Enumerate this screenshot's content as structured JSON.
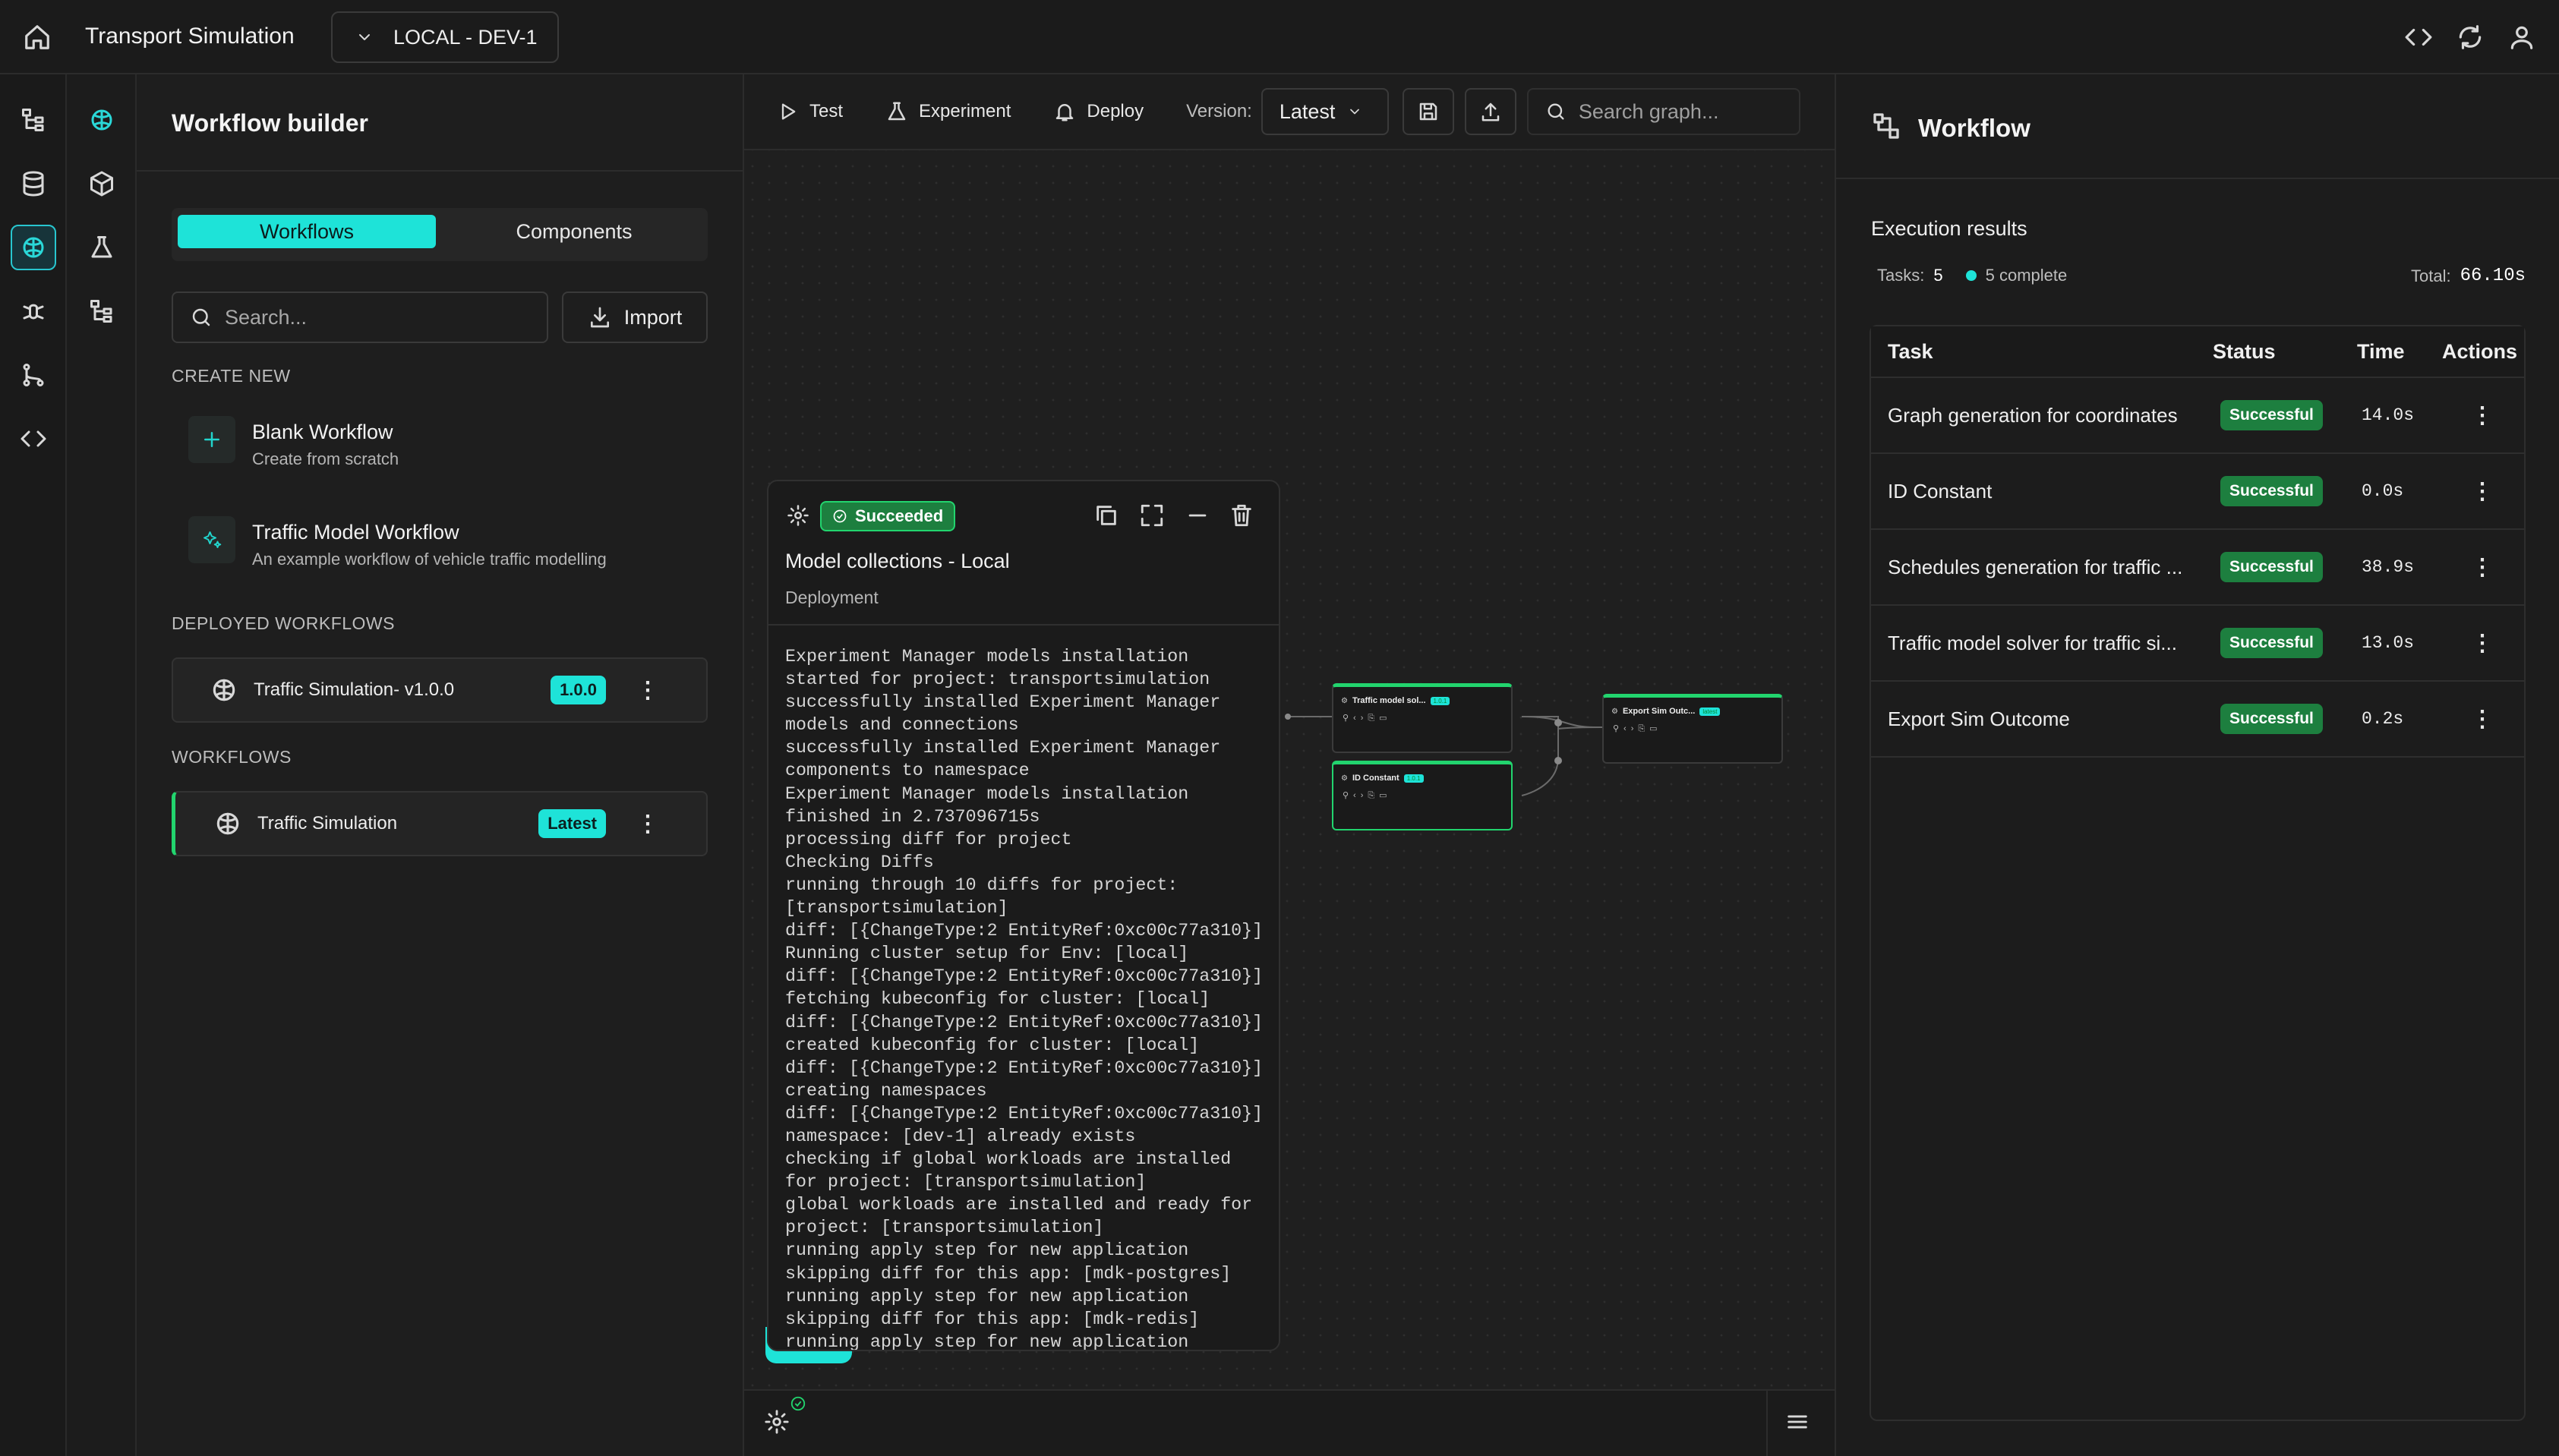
{
  "header": {
    "app_title": "Transport Simulation",
    "environment": "LOCAL - DEV-1"
  },
  "left_panel": {
    "title": "Workflow builder",
    "tabs": [
      "Workflows",
      "Components"
    ],
    "search_placeholder": "Search...",
    "import_label": "Import",
    "create_new_heading": "CREATE NEW",
    "create_items": [
      {
        "title": "Blank Workflow",
        "subtitle": "Create from scratch"
      },
      {
        "title": "Traffic Model Workflow",
        "subtitle": "An example workflow of vehicle traffic modelling"
      }
    ],
    "deployed_heading": "DEPLOYED WORKFLOWS",
    "deployed": {
      "name": "Traffic Simulation- v1.0.0",
      "badge": "1.0.0"
    },
    "workflows_heading": "WORKFLOWS",
    "workflow": {
      "name": "Traffic Simulation",
      "badge": "Latest"
    }
  },
  "toolbar": {
    "test": "Test",
    "experiment": "Experiment",
    "deploy": "Deploy",
    "version_label": "Version:",
    "version_value": "Latest",
    "search_placeholder": "Search graph..."
  },
  "log_panel": {
    "status": "Succeeded",
    "title": "Model collections - Local",
    "subtitle": "Deployment",
    "log": "Experiment Manager models installation\nstarted for project: transportsimulation\nsuccessfully installed Experiment Manager\nmodels and connections\nsuccessfully installed Experiment Manager\ncomponents to namespace\nExperiment Manager models installation\nfinished in 2.737096715s\nprocessing diff for project\nChecking Diffs\nrunning through 10 diffs for project:\n[transportsimulation]\ndiff: [{ChangeType:2 EntityRef:0xc00c77a310}]\nRunning cluster setup for Env: [local]\ndiff: [{ChangeType:2 EntityRef:0xc00c77a310}]\nfetching kubeconfig for cluster: [local]\ndiff: [{ChangeType:2 EntityRef:0xc00c77a310}]\ncreated kubeconfig for cluster: [local]\ndiff: [{ChangeType:2 EntityRef:0xc00c77a310}]\ncreating namespaces\ndiff: [{ChangeType:2 EntityRef:0xc00c77a310}]\nnamespace: [dev-1] already exists\nchecking if global workloads are installed\nfor project: [transportsimulation]\nglobal workloads are installed and ready for\nproject: [transportsimulation]\nrunning apply step for new application\nskipping diff for this app: [mdk-postgres]\nrunning apply step for new application\nskipping diff for this app: [mdk-redis]\nrunning apply step for new application"
  },
  "graph_nodes": [
    {
      "label": "Traffic model sol...",
      "badge": "1.0.1"
    },
    {
      "label": "ID Constant",
      "badge": "1.0.1"
    },
    {
      "label": "Export Sim Outc...",
      "badge": "latest"
    }
  ],
  "right_panel": {
    "title": "Workflow",
    "section": "Execution results",
    "tasks_label": "Tasks:",
    "tasks_count": "5",
    "complete": "5 complete",
    "total_label": "Total:",
    "total_value": "66.10s",
    "columns": [
      "Task",
      "Status",
      "Time",
      "Actions"
    ],
    "rows": [
      {
        "task": "Graph generation for coordinates",
        "status": "Successful",
        "time": "14.0s"
      },
      {
        "task": "ID Constant",
        "status": "Successful",
        "time": "0.0s"
      },
      {
        "task": "Schedules generation for traffic ...",
        "status": "Successful",
        "time": "38.9s"
      },
      {
        "task": "Traffic model solver for traffic si...",
        "status": "Successful",
        "time": "13.0s"
      },
      {
        "task": "Export Sim Outcome",
        "status": "Successful",
        "time": "0.2s"
      }
    ]
  },
  "colors": {
    "accent": "#1ee3d8",
    "success": "#1d7f3f",
    "node_border": "#22d46e"
  }
}
